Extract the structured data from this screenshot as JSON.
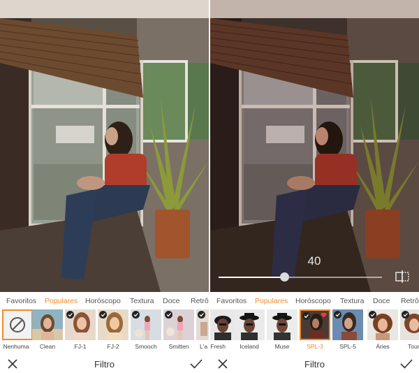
{
  "left": {
    "tabs": [
      {
        "label": "Favoritos",
        "active": false
      },
      {
        "label": "Populares",
        "active": true
      },
      {
        "label": "Horóscopo",
        "active": false
      },
      {
        "label": "Textura",
        "active": false
      },
      {
        "label": "Doce",
        "active": false
      },
      {
        "label": "Retrô",
        "active": false
      }
    ],
    "filters": [
      {
        "label": "Nenhuma",
        "checked": false,
        "selected": false,
        "favorite": false
      },
      {
        "label": "Clean",
        "checked": false,
        "selected": false,
        "favorite": false
      },
      {
        "label": "FJ-1",
        "checked": true,
        "selected": false,
        "favorite": false
      },
      {
        "label": "FJ-2",
        "checked": true,
        "selected": false,
        "favorite": false
      },
      {
        "label": "Smooch",
        "checked": true,
        "selected": false,
        "favorite": false
      },
      {
        "label": "Smitten",
        "checked": true,
        "selected": false,
        "favorite": false
      },
      {
        "label": "L'a",
        "checked": true,
        "selected": false,
        "favorite": false
      }
    ],
    "toolbar": {
      "title": "Filtro",
      "cancel_icon": "close-icon",
      "confirm_icon": "checkmark-icon"
    }
  },
  "right": {
    "tabs": [
      {
        "label": "Favoritos",
        "active": false
      },
      {
        "label": "Populares",
        "active": true
      },
      {
        "label": "Horóscopo",
        "active": false
      },
      {
        "label": "Textura",
        "active": false
      },
      {
        "label": "Doce",
        "active": false
      },
      {
        "label": "Retrô",
        "active": false
      }
    ],
    "filters": [
      {
        "label": "Fresh",
        "checked": false,
        "selected": false,
        "favorite": false
      },
      {
        "label": "Iceland",
        "checked": false,
        "selected": false,
        "favorite": false
      },
      {
        "label": "Muse",
        "checked": false,
        "selected": false,
        "favorite": false
      },
      {
        "label": "SPL-3",
        "checked": true,
        "selected": true,
        "favorite": true
      },
      {
        "label": "SPL-5",
        "checked": true,
        "selected": false,
        "favorite": false
      },
      {
        "label": "Áries",
        "checked": true,
        "selected": false,
        "favorite": false
      },
      {
        "label": "Tour",
        "checked": true,
        "selected": false,
        "favorite": false
      }
    ],
    "slider": {
      "value": "40",
      "fraction": 0.4
    },
    "compare_icon": "compare-icon",
    "toolbar": {
      "title": "Filtro",
      "cancel_icon": "close-icon",
      "confirm_icon": "checkmark-icon"
    }
  },
  "colors": {
    "accent": "#f08a2c",
    "text": "#333333",
    "tab_text": "#555555"
  }
}
